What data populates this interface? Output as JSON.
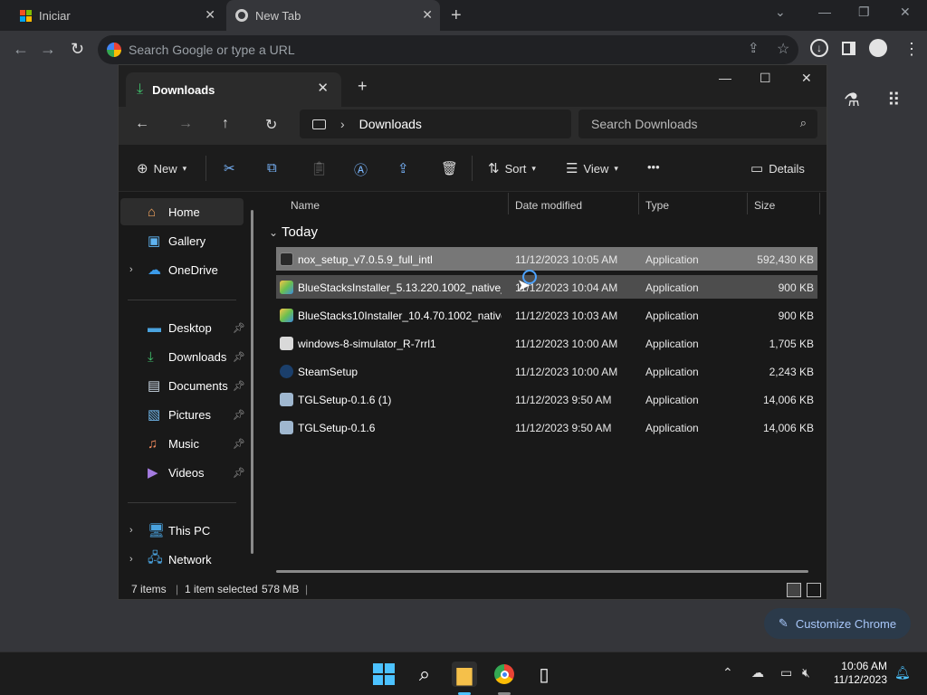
{
  "browser": {
    "tabs": [
      {
        "title": "Iniciar",
        "close": "✕"
      },
      {
        "title": "New Tab",
        "close": "✕"
      }
    ],
    "new_tab": "+",
    "omnibox_placeholder": "Search Google or type a URL",
    "customize": "Customize Chrome"
  },
  "explorer": {
    "tab_title": "Downloads",
    "tab_close": "✕",
    "new_tab": "+",
    "address": "Downloads",
    "search_placeholder": "Search Downloads",
    "toolbar": {
      "new": "New",
      "sort": "Sort",
      "view": "View",
      "more": "•••",
      "details": "Details"
    },
    "nav": {
      "home": "Home",
      "gallery": "Gallery",
      "onedrive": "OneDrive",
      "desktop": "Desktop",
      "downloads": "Downloads",
      "documents": "Documents",
      "pictures": "Pictures",
      "music": "Music",
      "videos": "Videos",
      "thispc": "This PC",
      "network": "Network"
    },
    "columns": {
      "name": "Name",
      "date": "Date modified",
      "type": "Type",
      "size": "Size"
    },
    "group": "Today",
    "files": [
      {
        "name": "nox_setup_v7.0.5.9_full_intl",
        "date": "11/12/2023 10:05 AM",
        "type": "Application",
        "size": "592,430 KB"
      },
      {
        "name": "BlueStacksInstaller_5.13.220.1002_native_...",
        "date": "11/12/2023 10:04 AM",
        "type": "Application",
        "size": "900 KB"
      },
      {
        "name": "BlueStacks10Installer_10.4.70.1002_native...",
        "date": "11/12/2023 10:03 AM",
        "type": "Application",
        "size": "900 KB"
      },
      {
        "name": "windows-8-simulator_R-7rrl1",
        "date": "11/12/2023 10:00 AM",
        "type": "Application",
        "size": "1,705 KB"
      },
      {
        "name": "SteamSetup",
        "date": "11/12/2023 10:00 AM",
        "type": "Application",
        "size": "2,243 KB"
      },
      {
        "name": "TGLSetup-0.1.6 (1)",
        "date": "11/12/2023 9:50 AM",
        "type": "Application",
        "size": "14,006 KB"
      },
      {
        "name": "TGLSetup-0.1.6",
        "date": "11/12/2023 9:50 AM",
        "type": "Application",
        "size": "14,006 KB"
      }
    ],
    "status": {
      "items": "7 items",
      "selected": "1 item selected",
      "size": "578 MB"
    }
  },
  "taskbar": {
    "time": "10:06 AM",
    "date": "11/12/2023"
  },
  "colors": {
    "accent": "#4da3ff",
    "folder": "#f5c04a",
    "selected_row": "#777777"
  }
}
